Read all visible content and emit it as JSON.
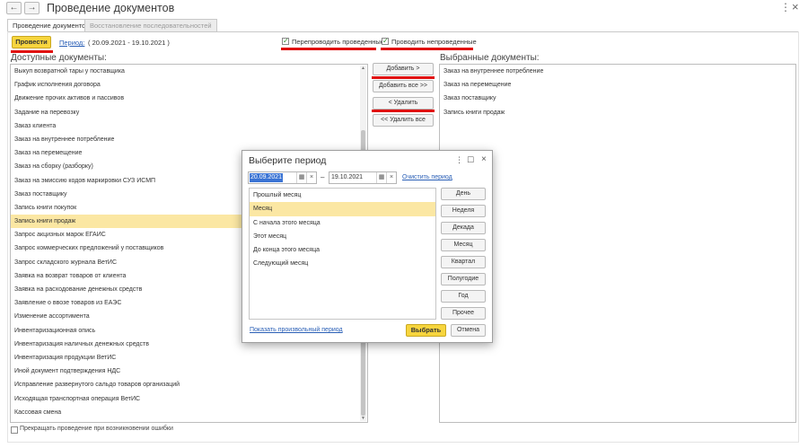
{
  "window": {
    "title": "Проведение документов",
    "back_icon": "←",
    "forward_icon": "→",
    "more_icon": "⋮",
    "close_icon": "×"
  },
  "tabs": [
    {
      "label": "Проведение документов",
      "active": true
    },
    {
      "label": "Восстановление последовательностей",
      "active": false
    }
  ],
  "toolbar": {
    "post_button": "Провести",
    "period_link": "Период:",
    "period_value": "( 20.09.2021 - 19.10.2021 )",
    "repost_checkbox": {
      "label": "Перепроводить проведенные",
      "checked": true
    },
    "post_unposted_checkbox": {
      "label": "Проводить непроведенные",
      "checked": true
    },
    "check_glyph": "✓"
  },
  "available": {
    "heading": "Доступные документы:",
    "items": [
      "Выкуп возвратной тары у поставщика",
      "График исполнения договора",
      "Движение прочих активов и пассивов",
      "Задание на перевозку",
      "Заказ клиента",
      "Заказ на внутреннее потребление",
      "Заказ на перемещение",
      "Заказ на сборку (разборку)",
      "Заказ на эмиссию кодов маркировки СУЗ ИСМП",
      "Заказ поставщику",
      "Запись книги покупок",
      "Запись книги продаж",
      "Запрос акцизных марок ЕГАИС",
      "Запрос коммерческих предложений у поставщиков",
      "Запрос складского журнала ВетИС",
      "Заявка на возврат товаров от клиента",
      "Заявка на расходование денежных средств",
      "Заявление о ввозе товаров из ЕАЭС",
      "Изменение ассортимента",
      "Инвентаризационная опись",
      "Инвентаризация наличных денежных средств",
      "Инвентаризация продукции ВетИС",
      "Иной документ подтверждения НДС",
      "Исправление развернутого сальдо товаров организаций",
      "Исходящая транспортная операция ВетИС",
      "Кассовая смена"
    ],
    "selected_index": 11,
    "scroll_up": "▲",
    "scroll_down": "▼"
  },
  "transfer_buttons": {
    "add": "Добавить >",
    "add_all": "Добавить все >>",
    "remove": "< Удалить",
    "remove_all": "<< Удалить все"
  },
  "selected": {
    "heading": "Выбранные документы:",
    "items": [
      "Заказ на внутреннее потребление",
      "Заказ на перемещение",
      "Заказ поставщику",
      "Запись книги продаж"
    ]
  },
  "stop_on_error": {
    "label": "Прекращать проведение при возникновении ошибки",
    "checked": false
  },
  "dialog": {
    "title": "Выберите период",
    "more_icon": "⋮",
    "maximize_icon": "☐",
    "close_icon": "×",
    "date_from": "20.09.2021",
    "date_to": "19.10.2021",
    "dash": "–",
    "calendar_icon": "▦",
    "clear_icon": "×",
    "clear_link": "Очистить период",
    "periods": [
      "Прошлый месяц",
      "Месяц",
      "С начала этого месяца",
      "Этот месяц",
      "До конца этого месяца",
      "Следующий месяц"
    ],
    "selected_period_index": 1,
    "side_buttons": [
      "День",
      "Неделя",
      "Декада",
      "Месяц",
      "Квартал",
      "Полугодие",
      "Год",
      "Прочее"
    ],
    "custom_link": "Показать произвольный период",
    "ok_button": "Выбрать",
    "cancel_button": "Отмена"
  },
  "highlight_color": "#e01010",
  "selection_color": "#fbe7a3",
  "accent_button_color": "#f7d53e"
}
